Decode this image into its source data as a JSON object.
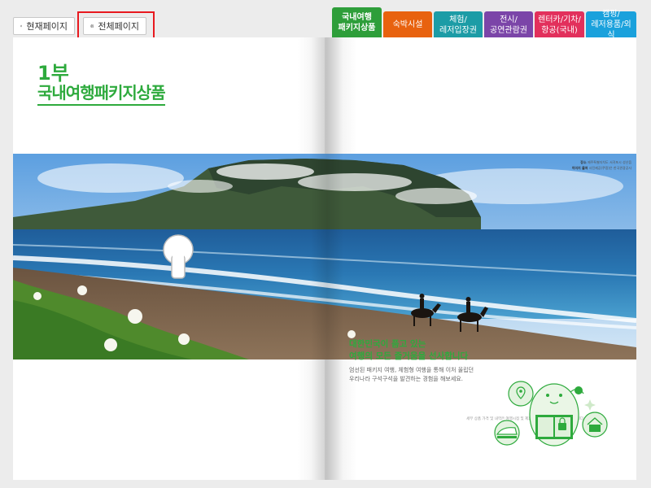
{
  "toolbar": {
    "current_page_label": "현재페이지",
    "all_pages_label": "전체페이지"
  },
  "tabs": [
    {
      "line1": "국내여행",
      "line2": "패키지상품",
      "color": "#2e9e3a",
      "active": true
    },
    {
      "line1": "숙박시설",
      "line2": "",
      "color": "#e8620f",
      "active": false
    },
    {
      "line1": "체험/",
      "line2": "레저입장권",
      "color": "#1c9ca6",
      "active": false
    },
    {
      "line1": "전시/",
      "line2": "공연관람권",
      "color": "#7b45a8",
      "active": false
    },
    {
      "line1": "렌터카/기차/",
      "line2": "항공(국내)",
      "color": "#e2305c",
      "active": false
    },
    {
      "line1": "캠핑/",
      "line2": "레저용품/외식",
      "color": "#1aa1dc",
      "active": false
    }
  ],
  "left_page": {
    "part_number": "1부",
    "part_title": "국내여행패키지상품"
  },
  "photo": {
    "caption_place": "장소",
    "caption_place_value": "제주특별자치도 서귀포시 성산읍",
    "caption_source": "이미지 출처",
    "caption_source_value": "사진제공(쿠팡)은 한국관광공사"
  },
  "right_page": {
    "heading_line1": "대한민국이 품고 있는",
    "heading_line2": "여행의 모든 즐거움을 선사합니다",
    "body_line1": "엄선된 패키지 여행, 체험형 여행을 통해 이처 올립던",
    "body_line2": "우리나라 구석구석을 발견하는 경험을 해보세요.",
    "note": "세부 상품 가격 및 내역은 여행시점 및 제휴사의 사정에 따라 변동이 있습니다."
  },
  "icons": {
    "print": "printer-icon",
    "location": "location-pin-icon",
    "train": "train-icon",
    "house": "house-icon",
    "ticket": "ticket-icon"
  },
  "colors": {
    "brand_green": "#2eaa3d",
    "highlight_red": "#e8191f"
  }
}
